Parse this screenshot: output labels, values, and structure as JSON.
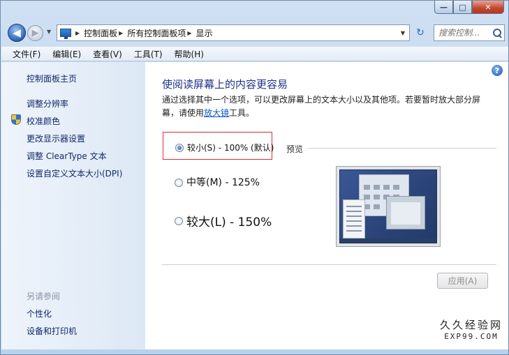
{
  "window": {
    "minimize_symbol": "—",
    "maximize_symbol": "□",
    "close_symbol": "✕"
  },
  "nav": {
    "back_symbol": "◀",
    "forward_symbol": "▶",
    "breadcrumbs": [
      "控制面板",
      "所有控制面板项",
      "显示"
    ],
    "search_placeholder": "搜索控制...",
    "refresh_symbol": "↻"
  },
  "menu": [
    "文件(F)",
    "编辑(E)",
    "查看(V)",
    "工具(T)",
    "帮助(H)"
  ],
  "sidebar": {
    "home": "控制面板主页",
    "links": [
      "调整分辨率",
      "校准颜色",
      "更改显示器设置",
      "调整 ClearType 文本",
      "设置自定义文本大小(DPI)"
    ],
    "see_also_heading": "另请参阅",
    "see_also": [
      "个性化",
      "设备和打印机"
    ]
  },
  "content": {
    "title": "使阅读屏幕上的内容更容易",
    "desc_before": "通过选择其中一个选项，可以更改屏幕上的文本大小以及其他项。若要暂时放大部分屏幕，请使用",
    "desc_link": "放大镜",
    "desc_after": "工具。",
    "options": [
      {
        "label": "较小(S) - 100% (默认)",
        "checked": true
      },
      {
        "label": "中等(M) - 125%",
        "checked": false
      },
      {
        "label": "较大(L) - 150%",
        "checked": false
      }
    ],
    "preview_label": "预览",
    "apply_label": "应用(A)",
    "help_symbol": "?"
  },
  "watermark": {
    "line1": "久久经验网",
    "line2": "EXP99.COM"
  }
}
